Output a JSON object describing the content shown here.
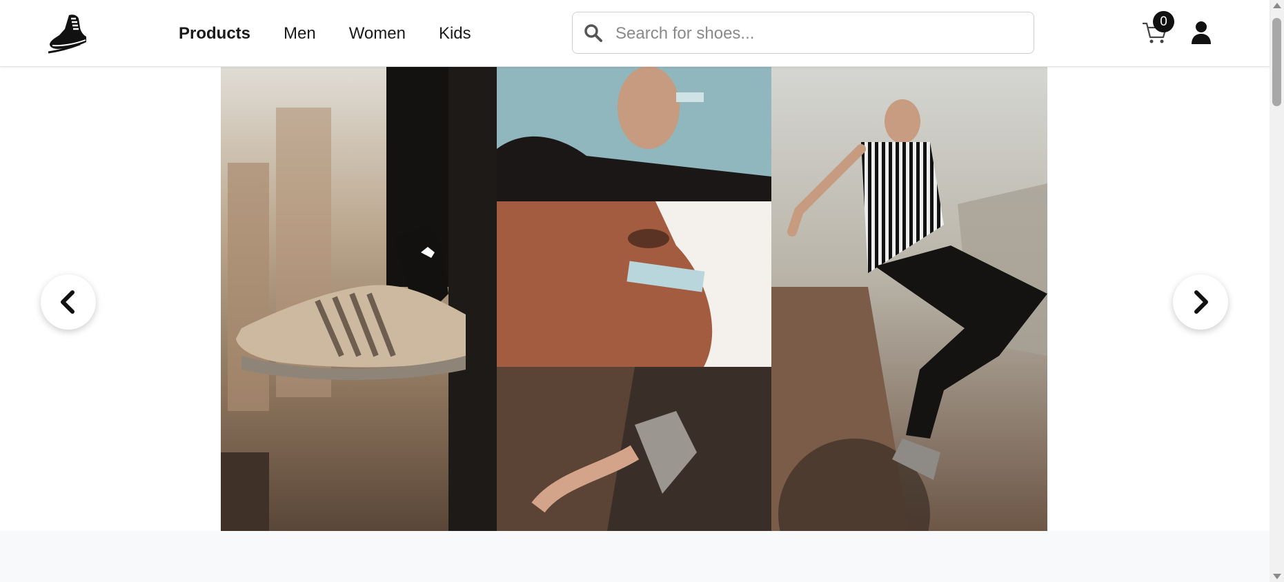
{
  "header": {
    "logo_icon": "running-shoe-logo",
    "nav": [
      {
        "label": "Products",
        "active": true
      },
      {
        "label": "Men",
        "active": false
      },
      {
        "label": "Women",
        "active": false
      },
      {
        "label": "Kids",
        "active": false
      }
    ],
    "search": {
      "placeholder": "Search for shoes...",
      "value": "",
      "icon": "search-icon"
    },
    "cart": {
      "icon": "cart-icon",
      "count": "0"
    },
    "user_icon": "user-icon"
  },
  "carousel": {
    "prev_icon": "chevron-left-icon",
    "next_icon": "chevron-right-icon",
    "slides": [
      "sneaker-campaign-collage"
    ]
  },
  "colors": {
    "text": "#1a1a1a",
    "badge_bg": "#111111",
    "search_border": "#cfcfcf",
    "band": "#f8f9fb"
  }
}
